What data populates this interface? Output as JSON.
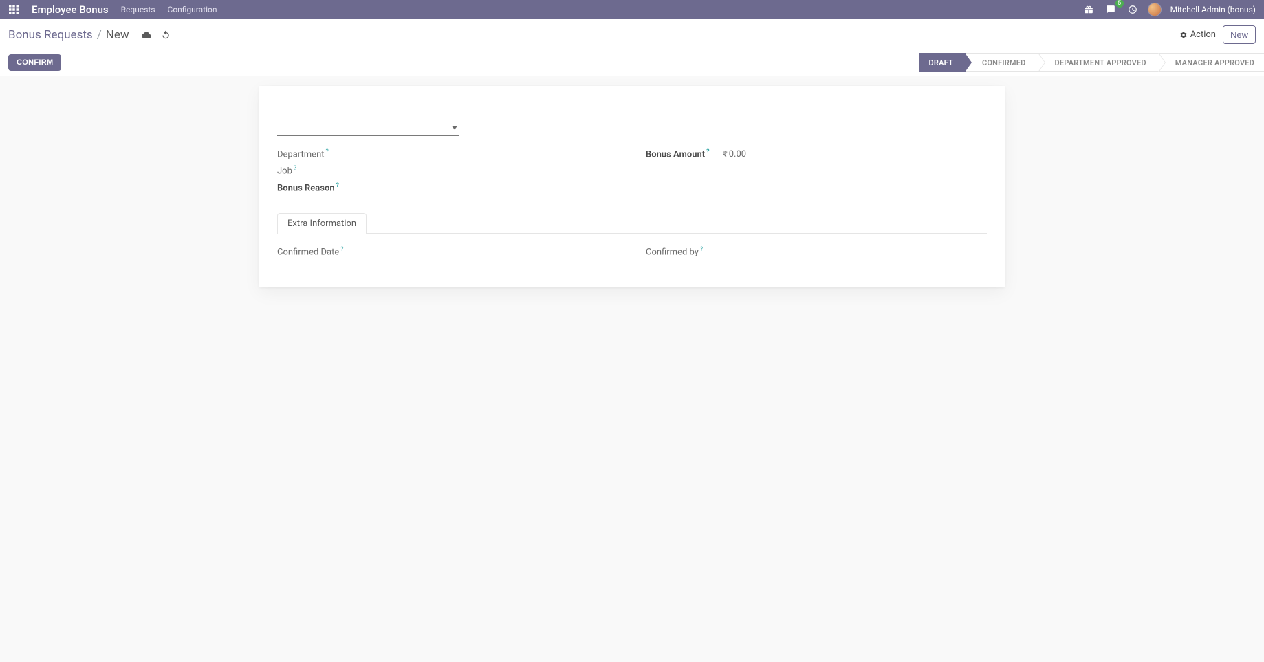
{
  "topnav": {
    "app_title": "Employee Bonus",
    "links": [
      "Requests",
      "Configuration"
    ],
    "message_badge": "5",
    "username": "Mitchell Admin (bonus)"
  },
  "breadcrumb": {
    "root": "Bonus Requests",
    "current": "New"
  },
  "controlbar": {
    "action_label": "Action",
    "new_label": "New"
  },
  "statusbar": {
    "confirm_label": "CONFIRM",
    "steps": [
      "DRAFT",
      "CONFIRMED",
      "DEPARTMENT APPROVED",
      "MANAGER APPROVED"
    ],
    "active_index": 0
  },
  "form": {
    "fields": {
      "department": {
        "label": "Department"
      },
      "job": {
        "label": "Job"
      },
      "bonus_reason": {
        "label": "Bonus Reason"
      },
      "bonus_amount": {
        "label": "Bonus Amount",
        "currency": "₹",
        "value": "0.00"
      }
    },
    "tabs": {
      "extra_info": {
        "label": "Extra Information",
        "fields": {
          "confirmed_date": {
            "label": "Confirmed Date"
          },
          "confirmed_by": {
            "label": "Confirmed by"
          }
        }
      }
    }
  }
}
